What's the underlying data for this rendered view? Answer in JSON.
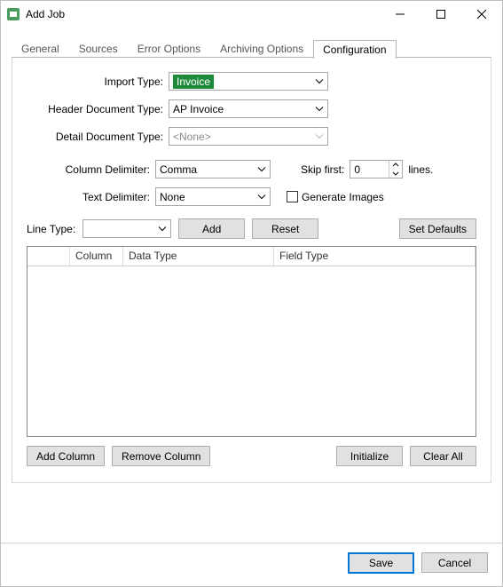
{
  "window": {
    "title": "Add Job"
  },
  "tabs": {
    "general": "General",
    "sources": "Sources",
    "error_options": "Error Options",
    "archiving_options": "Archiving Options",
    "configuration": "Configuration"
  },
  "form": {
    "import_type_label": "Import Type:",
    "import_type_value": "Invoice",
    "header_doc_type_label": "Header Document Type:",
    "header_doc_type_value": "AP Invoice",
    "detail_doc_type_label": "Detail Document Type:",
    "detail_doc_type_value": "<None>",
    "column_delim_label": "Column Delimiter:",
    "column_delim_value": "Comma",
    "text_delim_label": "Text Delimiter:",
    "text_delim_value": "None",
    "skip_first_label": "Skip first:",
    "skip_first_value": "0",
    "lines_suffix": "lines.",
    "generate_images_label": "Generate Images",
    "line_type_label": "Line Type:",
    "line_type_value": ""
  },
  "buttons": {
    "add": "Add",
    "reset": "Reset",
    "set_defaults": "Set Defaults",
    "add_column": "Add Column",
    "remove_column": "Remove Column",
    "initialize": "Initialize",
    "clear_all": "Clear All",
    "save": "Save",
    "cancel": "Cancel"
  },
  "grid": {
    "col0": "",
    "col1": "Column",
    "col2": "Data Type",
    "col3": "Field Type"
  }
}
